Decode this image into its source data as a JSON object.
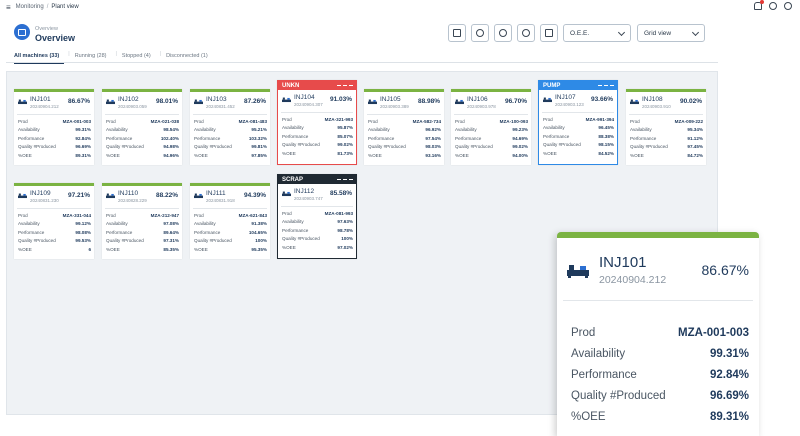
{
  "breadcrumb": [
    "Monitoring",
    "Plant view"
  ],
  "header": {
    "subtitle": "Overview",
    "title": "Overview"
  },
  "toolbar": {
    "kpi_select": "O.E.E.",
    "view_select": "Grid view"
  },
  "tabs": [
    "All machines (33)",
    "Running (28)",
    "Stopped (4)",
    "Disconnected (1)"
  ],
  "row_labels": [
    "Prod",
    "Availability",
    "Performance",
    "Quality #Produced",
    "%OEE"
  ],
  "machines": [
    {
      "name": "INJ101",
      "date": "20240904.212",
      "oee": "86.67%",
      "prod": "MZA-001-003",
      "availability": "99.31%",
      "performance": "92.84%",
      "quality": "96.69%",
      "poee": "89.31%",
      "banner": ""
    },
    {
      "name": "INJ102",
      "date": "20240903.059",
      "oee": "98.01%",
      "prod": "MZA-021-038",
      "availability": "98.54%",
      "performance": "102.40%",
      "quality": "94.98%",
      "poee": "94.96%",
      "banner": ""
    },
    {
      "name": "INJ103",
      "date": "20240831.452",
      "oee": "87.26%",
      "prod": "MZA-081-483",
      "availability": "95.21%",
      "performance": "103.32%",
      "quality": "99.81%",
      "poee": "97.85%",
      "banner": ""
    },
    {
      "name": "INJ104",
      "date": "20240904.307",
      "oee": "91.03%",
      "prod": "MZA-321-993",
      "availability": "95.87%",
      "performance": "85.07%",
      "quality": "99.02%",
      "poee": "81.73%",
      "banner": "UNKN"
    },
    {
      "name": "INJ105",
      "date": "20240903.389",
      "oee": "88.98%",
      "prod": "MZA-582-734",
      "availability": "96.92%",
      "performance": "97.54%",
      "quality": "98.03%",
      "poee": "93.16%",
      "banner": ""
    },
    {
      "name": "INJ106",
      "date": "20240903.978",
      "oee": "96.70%",
      "prod": "MZA-100-093",
      "availability": "99.23%",
      "performance": "94.69%",
      "quality": "99.02%",
      "poee": "94.00%",
      "banner": ""
    },
    {
      "name": "INJ107",
      "date": "20240903.123",
      "oee": "93.66%",
      "prod": "MZA-991-394",
      "availability": "96.45%",
      "performance": "88.38%",
      "quality": "98.15%",
      "poee": "84.52%",
      "banner": "PUMP"
    },
    {
      "name": "INJ108",
      "date": "20240903.910",
      "oee": "90.02%",
      "prod": "MZA-009-222",
      "availability": "95.34%",
      "performance": "91.12%",
      "quality": "97.45%",
      "poee": "84.72%",
      "banner": ""
    },
    {
      "name": "INJ109",
      "date": "20240831.230",
      "oee": "97.21%",
      "prod": "MZA-331-044",
      "availability": "99.12%",
      "performance": "98.08%",
      "quality": "99.53%",
      "poee": "6",
      "banner": ""
    },
    {
      "name": "INJ110",
      "date": "20240828.229",
      "oee": "88.22%",
      "prod": "MZA-212-947",
      "availability": "97.08%",
      "performance": "89.64%",
      "quality": "97.31%",
      "poee": "85.35%",
      "banner": ""
    },
    {
      "name": "INJ111",
      "date": "20240831.918",
      "oee": "94.39%",
      "prod": "MZA-621-843",
      "availability": "91.38%",
      "performance": "104.65%",
      "quality": "100%",
      "poee": "95.35%",
      "banner": ""
    },
    {
      "name": "INJ112",
      "date": "20240903.747",
      "oee": "85.58%",
      "prod": "MZA-081-993",
      "availability": "97.63%",
      "performance": "98.78%",
      "quality": "100%",
      "poee": "97.02%",
      "banner": "SCRAP"
    }
  ],
  "zoom": {
    "name": "INJ101",
    "date": "20240904.212",
    "oee": "86.67%",
    "prod": "MZA-001-003",
    "availability": "99.31%",
    "performance": "92.84%",
    "quality": "96.69%",
    "poee": "89.31%"
  },
  "colors": {
    "running": "#7bb342",
    "unkn": "#e74b4b",
    "pump": "#2e8ae6",
    "scrap": "#202a33",
    "accent": "#2c6fd1"
  }
}
